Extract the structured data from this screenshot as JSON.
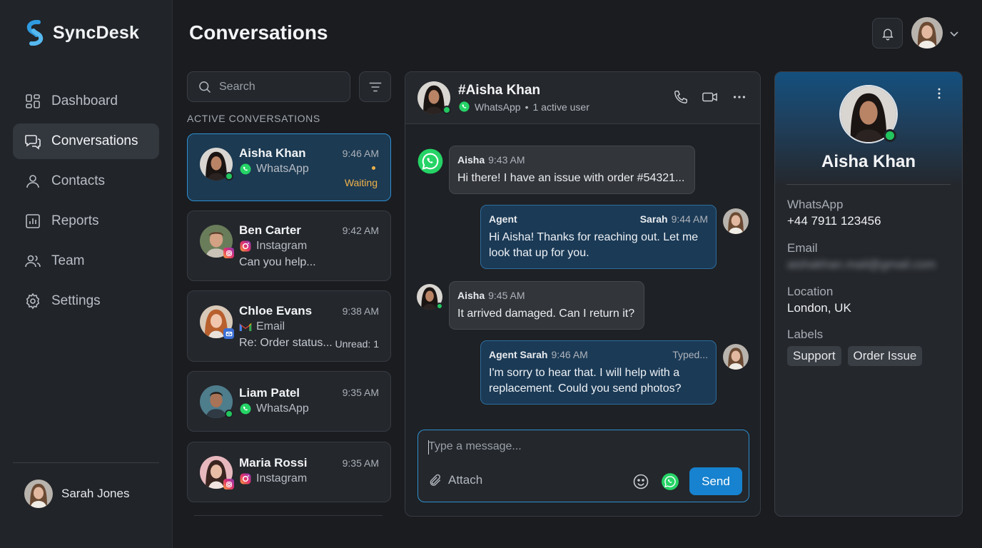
{
  "app": {
    "name": "SyncDesk",
    "colors": {
      "accent": "#1782cf",
      "online": "#22c55e",
      "waiting": "#f0b24a",
      "whatsapp": "#25d366"
    }
  },
  "sidebar": {
    "items": [
      {
        "label": "Dashboard",
        "icon": "dashboard-icon",
        "active": false
      },
      {
        "label": "Conversations",
        "icon": "conversations-icon",
        "active": true
      },
      {
        "label": "Contacts",
        "icon": "contacts-icon",
        "active": false
      },
      {
        "label": "Reports",
        "icon": "reports-icon",
        "active": false
      },
      {
        "label": "Team",
        "icon": "team-icon",
        "active": false
      },
      {
        "label": "Settings",
        "icon": "settings-icon",
        "active": false
      }
    ],
    "current_user": {
      "name": "Sarah Jones"
    }
  },
  "header": {
    "title": "Conversations"
  },
  "list": {
    "search_placeholder": "Search",
    "section_label": "ACTIVE CONVERSATIONS",
    "conversations": [
      {
        "name": "Aisha Khan",
        "time": "9:46 AM",
        "channel": "WhatsApp",
        "status": "Waiting"
      },
      {
        "name": "Ben Carter",
        "time": "9:42 AM",
        "channel": "Instagram",
        "preview": "Can you help..."
      },
      {
        "name": "Chloe Evans",
        "time": "9:38 AM",
        "channel": "Email",
        "preview": "Re: Order status...",
        "unread_label": "Unread:",
        "unread_count": "1"
      },
      {
        "name": "Liam Patel",
        "time": "9:35 AM",
        "channel": "WhatsApp"
      },
      {
        "name": "Maria Rossi",
        "time": "9:35 AM",
        "channel": "Instagram"
      }
    ]
  },
  "chat": {
    "title": "#Aisha Khan",
    "channel": "WhatsApp",
    "separator": "•",
    "active_users": "1 active user",
    "messages": [
      {
        "sender": "Aisha",
        "time": "9:43 AM",
        "text": "Hi there! I have an issue with order #54321..."
      },
      {
        "sender": "Agent",
        "agent_name": "Sarah",
        "time": "9:44 AM",
        "text": "Hi Aisha! Thanks for reaching out. Let me look that up for you."
      },
      {
        "sender": "Aisha",
        "time": "9:45 AM",
        "text": "It arrived damaged. Can I return it?"
      },
      {
        "sender": "Agent Sarah",
        "time": "9:46 AM",
        "status": "Typed...",
        "text": "I'm sorry to hear that. I will help with a replacement. Could you send photos?"
      }
    ],
    "composer": {
      "placeholder": "Type a message...",
      "attach_label": "Attach",
      "send_label": "Send"
    }
  },
  "profile": {
    "name": "Aisha Khan",
    "fields": [
      {
        "label": "WhatsApp",
        "value": "+44 7911 123456"
      },
      {
        "label": "Email",
        "value": "aishakhan.mail@gmail.com"
      },
      {
        "label": "Location",
        "value": "London, UK"
      }
    ],
    "labels_title": "Labels",
    "labels": [
      "Support",
      "Order Issue"
    ]
  }
}
